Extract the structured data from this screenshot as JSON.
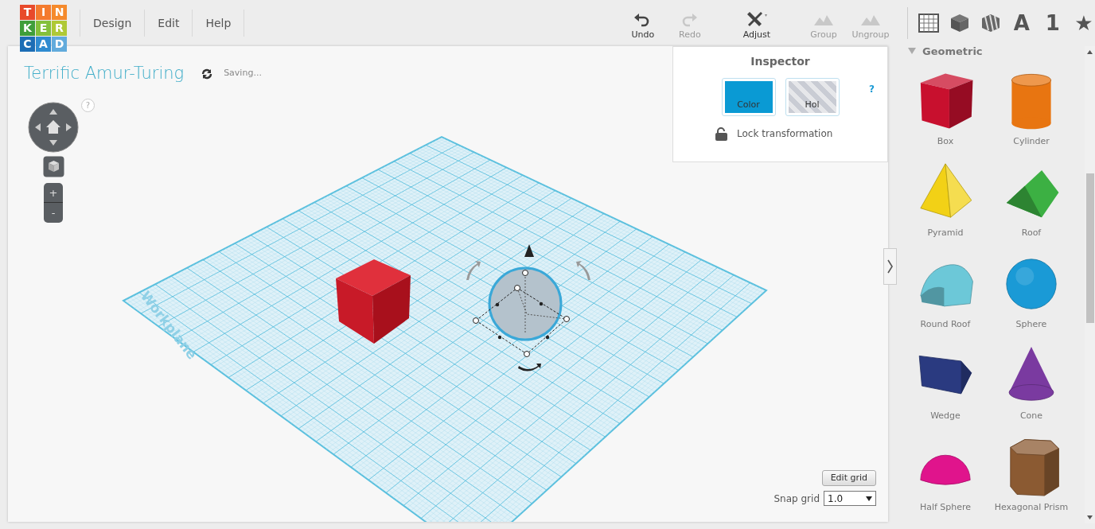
{
  "logo": {
    "letters": [
      {
        "text": "T",
        "color": "#e84a2b"
      },
      {
        "text": "I",
        "color": "#f47b2e"
      },
      {
        "text": "N",
        "color": "#f58a2c"
      },
      {
        "text": "K",
        "color": "#3f9e3a"
      },
      {
        "text": "E",
        "color": "#84c03a"
      },
      {
        "text": "R",
        "color": "#afc936"
      },
      {
        "text": "C",
        "color": "#1c6db5"
      },
      {
        "text": "A",
        "color": "#2f8bd0"
      },
      {
        "text": "D",
        "color": "#62abdc"
      }
    ]
  },
  "menu": [
    {
      "label": "Design"
    },
    {
      "label": "Edit"
    },
    {
      "label": "Help"
    }
  ],
  "toolbar": [
    {
      "label": "Undo",
      "disabled": false
    },
    {
      "label": "Redo",
      "disabled": true
    },
    {
      "label": "Adjust",
      "disabled": false
    },
    {
      "label": "Group",
      "disabled": true
    },
    {
      "label": "Ungroup",
      "disabled": true
    }
  ],
  "view_buttons": [
    {
      "kind": "icon"
    },
    {
      "kind": "icon"
    },
    {
      "kind": "icon"
    },
    {
      "kind": "glyph",
      "text": "A"
    },
    {
      "kind": "glyph",
      "text": "1"
    },
    {
      "kind": "glyph",
      "text": "★"
    }
  ],
  "design": {
    "title": "Terrific Amur-Turing",
    "status": "Saving..."
  },
  "view_controls": {
    "help": "?",
    "zoom_in": "+",
    "zoom_out": "-"
  },
  "workplane": {
    "label": "Workplane"
  },
  "inspector": {
    "title": "Inspector",
    "help": "?",
    "buttons": [
      {
        "kind": "color",
        "label": "Color"
      },
      {
        "kind": "hole",
        "label": "Hol"
      }
    ],
    "lock": "Lock transformation"
  },
  "grid": {
    "edit_button": "Edit grid",
    "snap_label": "Snap grid",
    "snap_value": "1.0"
  },
  "library": {
    "category": "Geometric",
    "expanded": true,
    "shapes": [
      {
        "name": "Box",
        "kind": "box",
        "color": "#c8102e"
      },
      {
        "name": "Cylinder",
        "kind": "cylinder",
        "color": "#e87511"
      },
      {
        "name": "Pyramid",
        "kind": "pyramid",
        "color": "#f2d116"
      },
      {
        "name": "Roof",
        "kind": "roof",
        "color": "#3cb043"
      },
      {
        "name": "Round Roof",
        "kind": "round-roof",
        "color": "#6cc8d8"
      },
      {
        "name": "Sphere",
        "kind": "sphere",
        "color": "#1a9ad6"
      },
      {
        "name": "Wedge",
        "kind": "wedge",
        "color": "#2a3a80"
      },
      {
        "name": "Cone",
        "kind": "cone",
        "color": "#7a3aa0"
      },
      {
        "name": "Half Sphere",
        "kind": "half-sphere",
        "color": "#e0148c"
      },
      {
        "name": "Hexagonal Prism",
        "kind": "hex-prism",
        "color": "#8b5a32"
      }
    ]
  }
}
